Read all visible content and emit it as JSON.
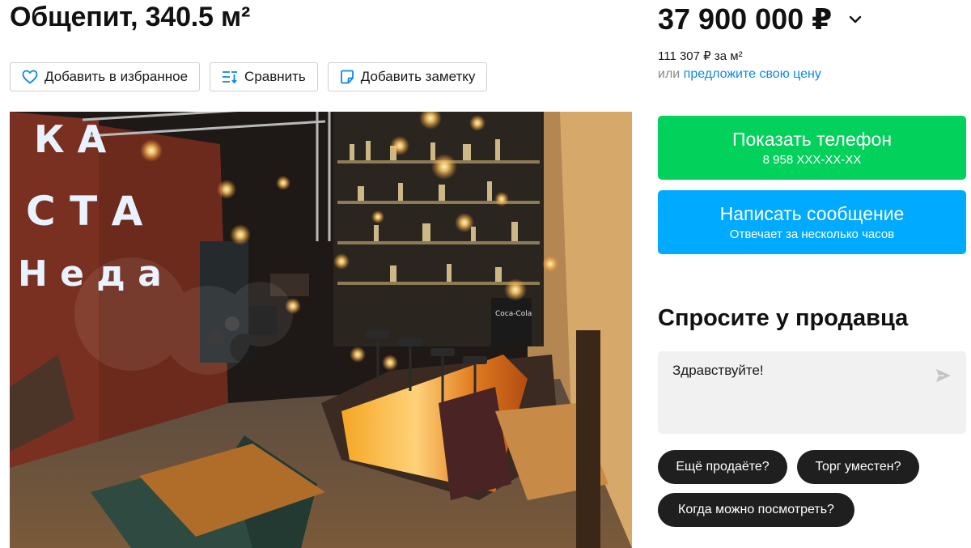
{
  "listing": {
    "title": "Общепит, 340.5 м²"
  },
  "actions": {
    "favorite_label": "Добавить в избранное",
    "compare_label": "Сравнить",
    "note_label": "Добавить заметку"
  },
  "price": {
    "value": "37 900 000 ₽",
    "per_sqm": "111 307 ₽ за м²",
    "offer_prefix": "или",
    "offer_link": "предложите свою цену"
  },
  "contact": {
    "phone_button_label": "Показать телефон",
    "phone_masked": "8 958 XXX-XX-XX",
    "message_button_label": "Написать сообщение",
    "message_response": "Отвечает за несколько часов"
  },
  "ask": {
    "title": "Спросите у продавца",
    "message_value": "Здравствуйте!",
    "chips": [
      "Ещё продаёте?",
      "Торг уместен?",
      "Когда можно посмотреть?"
    ]
  },
  "photo": {
    "wall_letters": [
      "К А",
      "С Т А",
      "Н е д а"
    ],
    "fridge_label": "Coca-Cola"
  },
  "colors": {
    "phone_button": "#02d15c",
    "message_button": "#00aaff",
    "link": "#0a8ae6",
    "chip_bg": "#1f1f1f",
    "input_bg": "#f1f1f1"
  },
  "icons": [
    "heart-icon",
    "compare-icon",
    "note-icon",
    "chevron-down-icon",
    "send-icon"
  ]
}
